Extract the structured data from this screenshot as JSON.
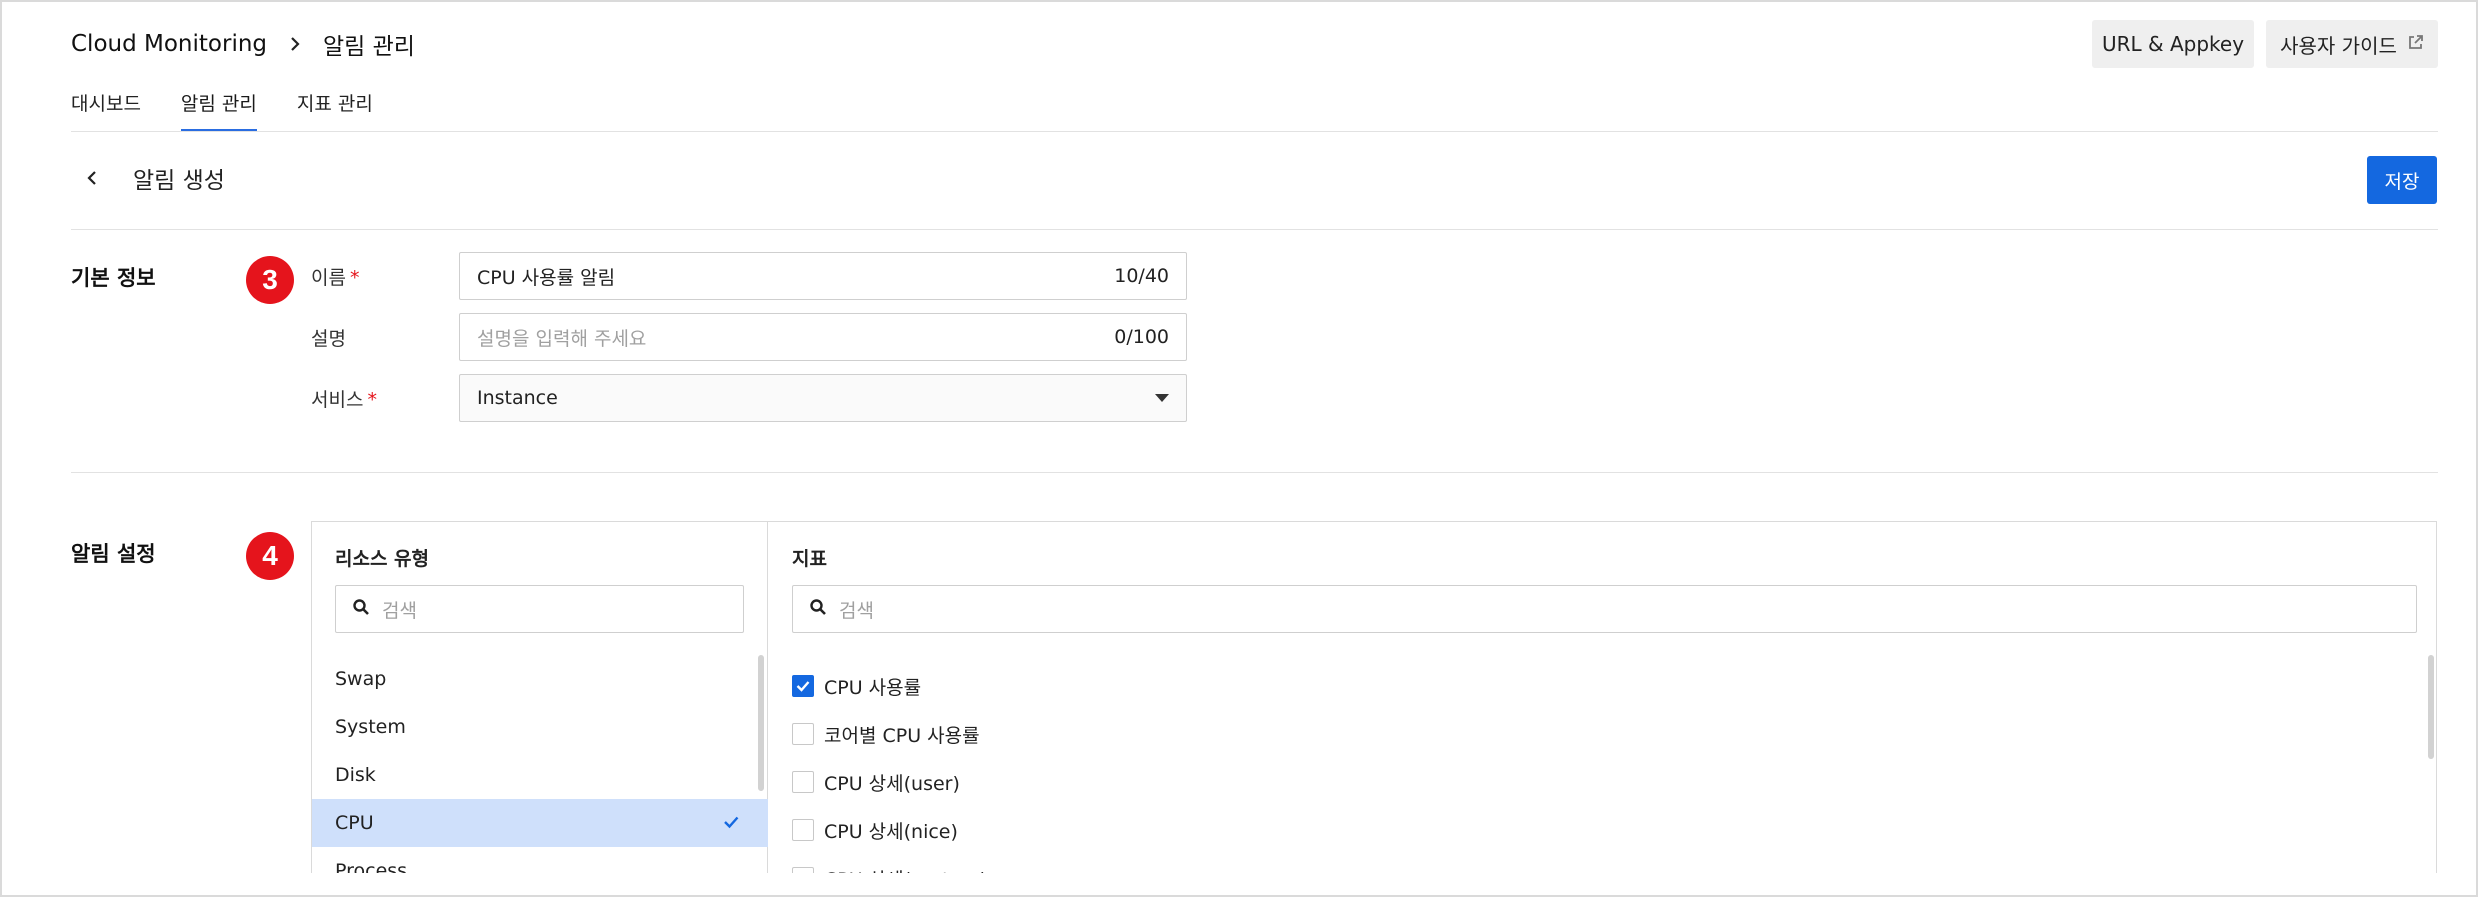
{
  "breadcrumb": {
    "root": "Cloud Monitoring",
    "current": "알림 관리"
  },
  "header_buttons": {
    "url_appkey": "URL & Appkey",
    "user_guide": "사용자 가이드"
  },
  "tabs": [
    {
      "label": "대시보드",
      "active": false
    },
    {
      "label": "알림 관리",
      "active": true
    },
    {
      "label": "지표 관리",
      "active": false
    }
  ],
  "page": {
    "title": "알림 생성",
    "save_label": "저장"
  },
  "basic_info": {
    "section_label": "기본 정보",
    "badge": "3",
    "name": {
      "label": "이름",
      "required": "*",
      "value": "CPU 사용률 알림",
      "count": "10/40"
    },
    "description": {
      "label": "설명",
      "placeholder": "설명을 입력해 주세요",
      "count": "0/100"
    },
    "service": {
      "label": "서비스",
      "required": "*",
      "value": "Instance"
    }
  },
  "alert_settings": {
    "section_label": "알림 설정",
    "badge": "4",
    "resource_type": {
      "title": "리소스 유형",
      "search_placeholder": "검색",
      "items": [
        {
          "label": "Swap",
          "selected": false
        },
        {
          "label": "System",
          "selected": false
        },
        {
          "label": "Disk",
          "selected": false
        },
        {
          "label": "CPU",
          "selected": true
        },
        {
          "label": "Process",
          "selected": false
        }
      ]
    },
    "metrics": {
      "title": "지표",
      "search_placeholder": "검색",
      "items": [
        {
          "label": "CPU 사용률",
          "checked": true
        },
        {
          "label": "코어별 CPU 사용률",
          "checked": false
        },
        {
          "label": "CPU 상세(user)",
          "checked": false
        },
        {
          "label": "CPU 상세(nice)",
          "checked": false
        },
        {
          "label": "CPU 상세(system)",
          "checked": false
        }
      ]
    }
  },
  "colors": {
    "accent": "#1468e0",
    "badge": "#e5141c",
    "selected_row": "#cfe0fb"
  }
}
